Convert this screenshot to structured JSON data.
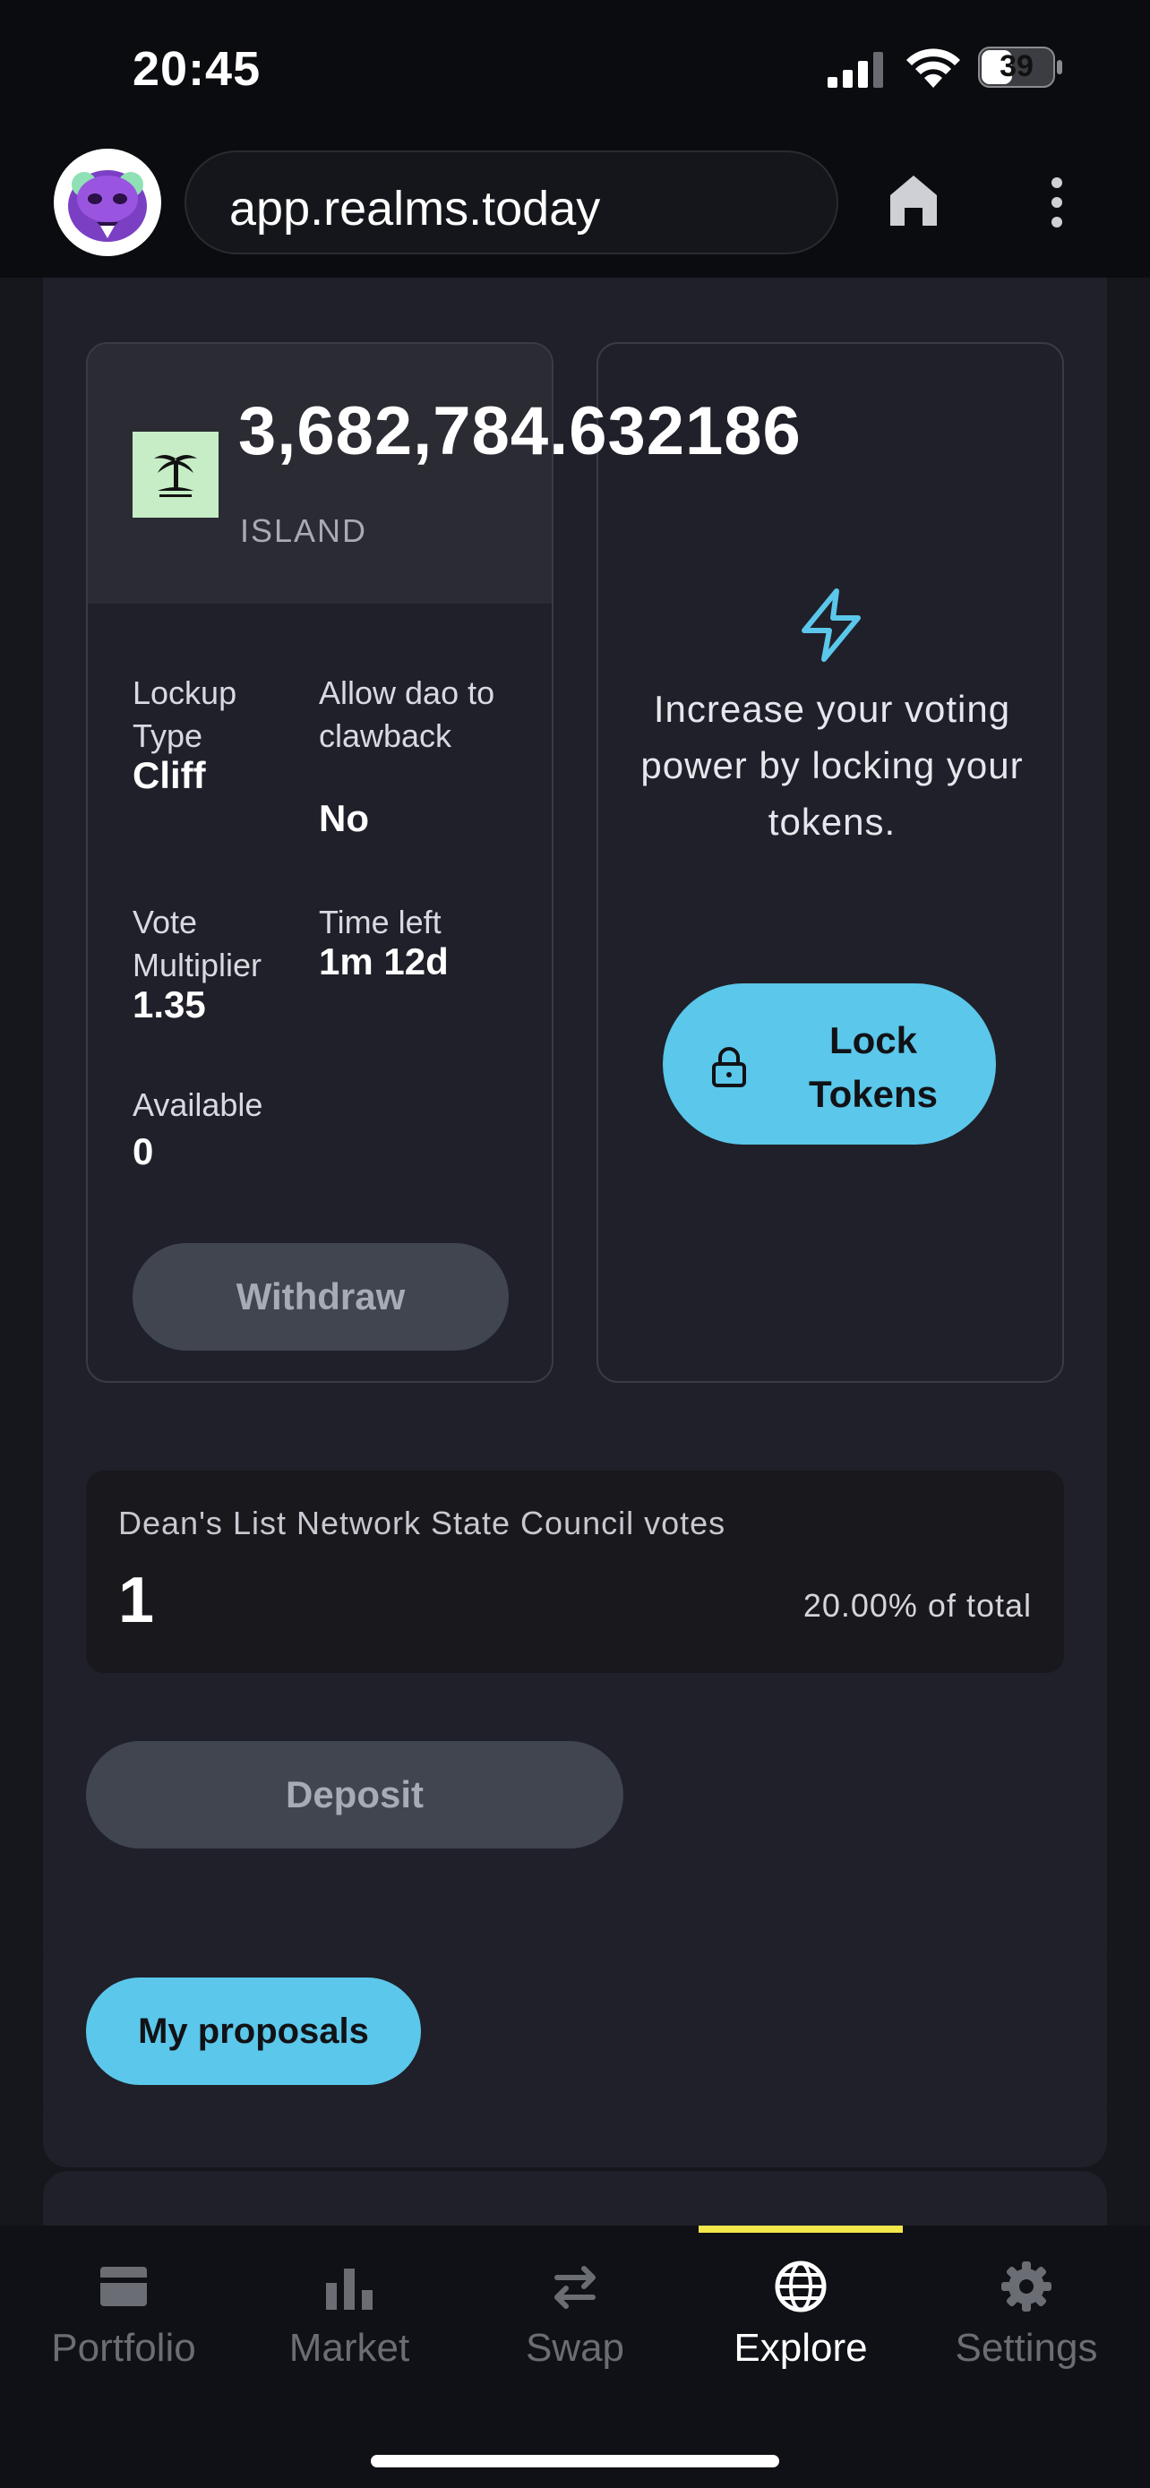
{
  "status_bar": {
    "time": "20:45",
    "battery": "39"
  },
  "browser": {
    "url": "app.realms.today"
  },
  "deposit_card": {
    "amount": "3,682,784.632186",
    "symbol": "ISLAND",
    "lockup_type_label": "Lockup Type",
    "lockup_type_value": "Cliff",
    "clawback_label": "Allow dao to clawback",
    "clawback_value": "No",
    "multiplier_label": "Vote Multiplier",
    "multiplier_value": "1.35",
    "time_left_label": "Time left",
    "time_left_value": "1m 12d",
    "available_label": "Available",
    "available_value": "0",
    "withdraw_label": "Withdraw"
  },
  "promo_card": {
    "text": "Increase your voting power by locking your tokens.",
    "lock_label": "Lock Tokens",
    "accent_color": "#5bc7ea"
  },
  "council_votes": {
    "title": "Dean's List Network State Council votes",
    "count": "1",
    "percent": "20.00% of total"
  },
  "deposit_button": "Deposit",
  "proposals_button": "My proposals",
  "tab_bar": {
    "active": "Explore",
    "indicator_color": "#f3e74a",
    "tabs": [
      {
        "label": "Portfolio",
        "icon": "portfolio-icon"
      },
      {
        "label": "Market",
        "icon": "bar-chart-icon"
      },
      {
        "label": "Swap",
        "icon": "swap-arrows-icon"
      },
      {
        "label": "Explore",
        "icon": "globe-icon"
      },
      {
        "label": "Settings",
        "icon": "gear-icon"
      }
    ]
  }
}
